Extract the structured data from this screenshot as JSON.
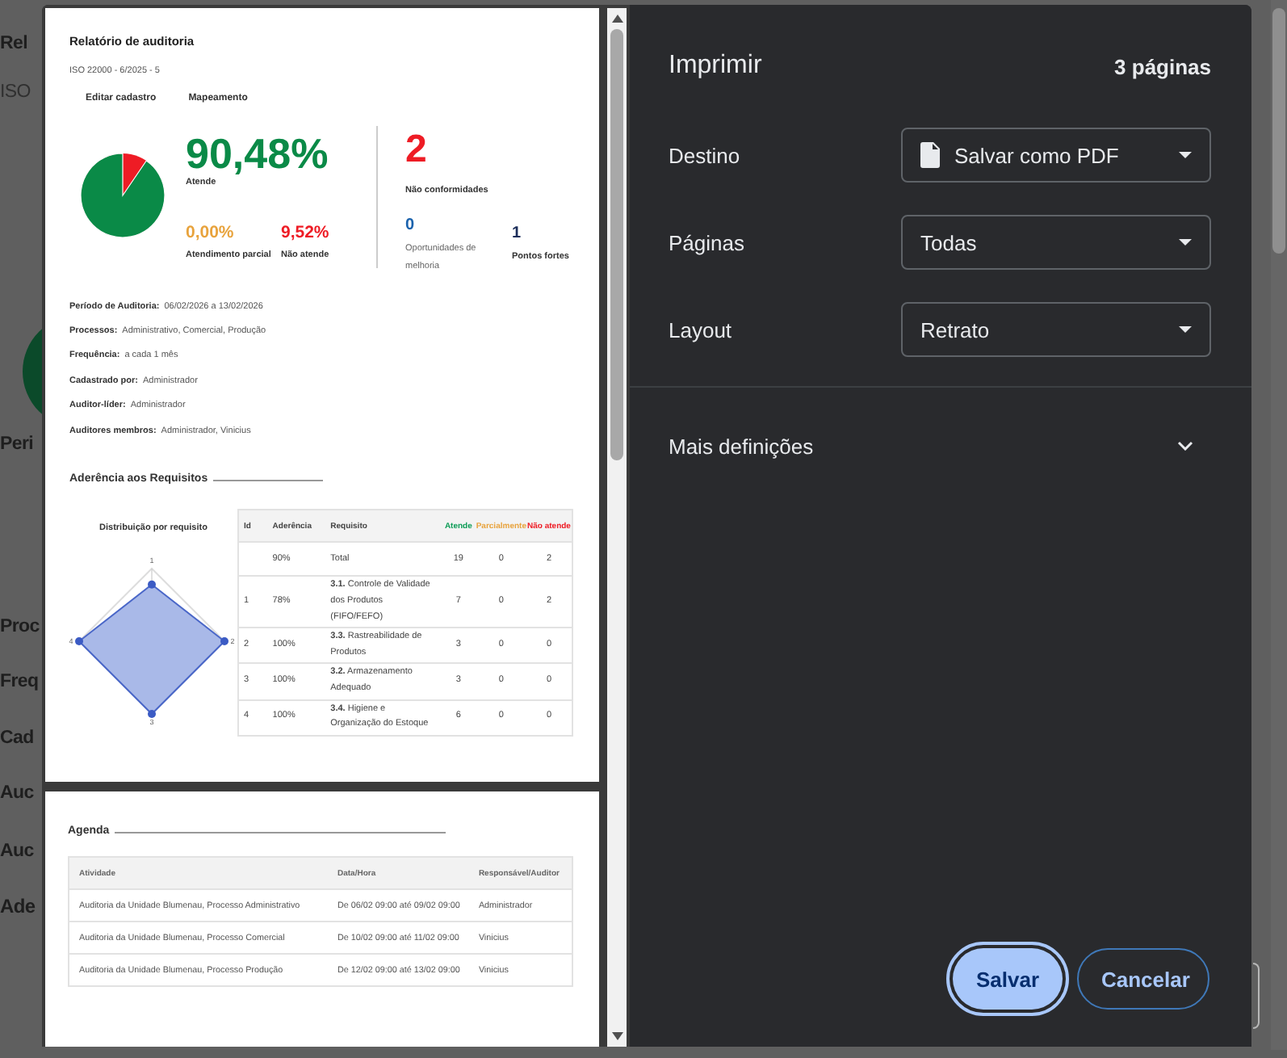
{
  "background_page": {
    "cut_texts": [
      "Rel",
      "ISO",
      "Peri",
      "Proc",
      "Freq",
      "Cad",
      "Auc",
      "Auc",
      "Ade"
    ]
  },
  "preview": {
    "report": {
      "title": "Relatório de auditoria",
      "subtitle": "ISO 22000 - 6/2025 - 5",
      "tabs": [
        "Editar cadastro",
        "Mapeamento"
      ],
      "summary": {
        "main": {
          "value": "90,48%",
          "label": "Atende"
        },
        "sub": [
          {
            "value": "0,00%",
            "label": "Atendimento parcial",
            "color": "#e8a33d"
          },
          {
            "value": "9,52%",
            "label": "Não atende",
            "color": "#ee1c25"
          }
        ],
        "nonconformities": {
          "value": "2",
          "label": "Não conformidades"
        },
        "extras": [
          {
            "value": "0",
            "label": "Oportunidades de melhoria",
            "color": "#1a62ad"
          },
          {
            "value": "1",
            "label": "Pontos fortes",
            "color": "#1b2d5a"
          }
        ]
      },
      "details": [
        {
          "label": "Período de Auditoria:",
          "value": "06/02/2026 a 13/02/2026"
        },
        {
          "label": "Processos:",
          "value": "Administrativo, Comercial, Produção"
        },
        {
          "label": "Frequência:",
          "value": "a cada 1 mês"
        },
        {
          "label": "Cadastrado por:",
          "value": "Administrador"
        },
        {
          "label": "Auditor-líder:",
          "value": "Administrador"
        },
        {
          "label": "Auditores membros:",
          "value": "Administrador, Vinicius"
        }
      ],
      "requirements": {
        "heading": "Aderência aos Requisitos",
        "chart_title": "Distribuição por requisito",
        "radar": [
          {
            "label": "1"
          },
          {
            "label": "2"
          },
          {
            "label": "3"
          },
          {
            "label": "4"
          }
        ],
        "columns": [
          {
            "label": "Id",
            "color": "#444444"
          },
          {
            "label": "Aderência",
            "color": "#444444"
          },
          {
            "label": "Requisito",
            "color": "#444444"
          },
          {
            "label": "Atende",
            "color": "#0f9d58"
          },
          {
            "label": "Parcialmente",
            "color": "#e8a33d"
          },
          {
            "label": "Não atende",
            "color": "#ee1c25"
          }
        ],
        "rows": [
          [
            "",
            "90%",
            "Total",
            "19",
            "0",
            "2"
          ],
          [
            "1",
            "78%",
            "**3.1.** Controle de Validade dos Produtos (FIFO/FEFO)",
            "7",
            "0",
            "2"
          ],
          [
            "2",
            "100%",
            "**3.3.** Rastreabilidade de Produtos",
            "3",
            "0",
            "0"
          ],
          [
            "3",
            "100%",
            "**3.2.** Armazenamento Adequado",
            "3",
            "0",
            "0"
          ],
          [
            "4",
            "100%",
            "**3.4.** Higiene e Organização do Estoque",
            "6",
            "0",
            "0"
          ]
        ]
      }
    },
    "agenda": {
      "heading": "Agenda",
      "columns": [
        "Atividade",
        "Data/Hora",
        "Responsável/Auditor"
      ],
      "rows": [
        [
          "Auditoria da Unidade Blumenau, Processo Administrativo",
          "De 06/02 09:00 até 09/02 09:00",
          "Administrador"
        ],
        [
          "Auditoria da Unidade Blumenau, Processo Comercial",
          "De 10/02 09:00 até 11/02 09:00",
          "Vinicius"
        ],
        [
          "Auditoria da Unidade Blumenau, Processo Produção",
          "De 12/02 09:00 até 13/02 09:00",
          "Vinicius"
        ]
      ]
    }
  },
  "settings": {
    "title": "Imprimir",
    "page_count": "3 páginas",
    "fields": [
      {
        "label": "Destino",
        "value": "Salvar como PDF",
        "kind": "destination"
      },
      {
        "label": "Páginas",
        "value": "Todas",
        "kind": "select"
      },
      {
        "label": "Layout",
        "value": "Retrato",
        "kind": "select"
      }
    ],
    "more_settings": {
      "label": "Mais definições",
      "expanded": false
    },
    "buttons": [
      {
        "label": "Salvar",
        "kind": "primary"
      },
      {
        "label": "Cancelar",
        "kind": "secondary"
      }
    ]
  }
}
